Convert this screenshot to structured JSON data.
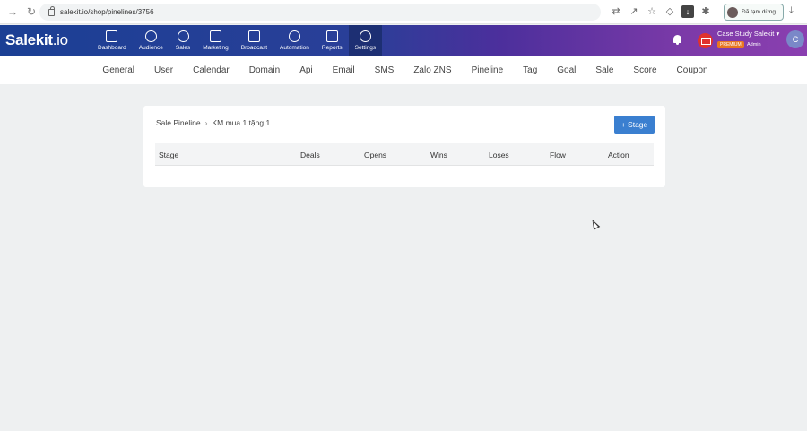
{
  "browser": {
    "url": "salekit.io/shop/pinelines/3756",
    "paused_label": "Đã tạm dừng"
  },
  "brand": {
    "name": "Salekit",
    "suffix": ".io"
  },
  "nav": {
    "items": [
      {
        "label": "Dashboard",
        "icon": "home-icon"
      },
      {
        "label": "Audience",
        "icon": "users-icon"
      },
      {
        "label": "Sales",
        "icon": "dollar-icon"
      },
      {
        "label": "Marketing",
        "icon": "chart-line-icon"
      },
      {
        "label": "Broadcast",
        "icon": "megaphone-icon"
      },
      {
        "label": "Automation",
        "icon": "refresh-icon"
      },
      {
        "label": "Reports",
        "icon": "bar-chart-icon"
      },
      {
        "label": "Settings",
        "icon": "gear-icon"
      }
    ],
    "active": "Settings"
  },
  "account": {
    "name": "Case Study Salekit",
    "badge": "PREMIUM",
    "role": "Admin",
    "avatar_letter": "C"
  },
  "tabs": [
    "General",
    "User",
    "Calendar",
    "Domain",
    "Api",
    "Email",
    "SMS",
    "Zalo ZNS",
    "Pineline",
    "Tag",
    "Goal",
    "Sale",
    "Score",
    "Coupon"
  ],
  "breadcrumb": {
    "parent": "Sale Pineline",
    "current": "KM mua 1 tặng 1"
  },
  "add_stage_label": "+ Stage",
  "table": {
    "columns": [
      "Stage",
      "Deals",
      "Opens",
      "Wins",
      "Loses",
      "Flow",
      "Action"
    ]
  },
  "colors": {
    "accent": "#3a7fd0",
    "nav_start": "#1b3f94",
    "nav_end": "#8a3fb0",
    "premium": "#e87722"
  }
}
